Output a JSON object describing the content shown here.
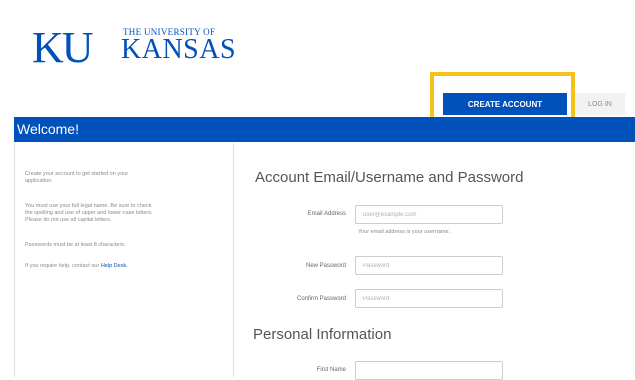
{
  "logo": {
    "ku": "KU",
    "university_line": "THE UNIVERSITY OF",
    "name": "KANSAS"
  },
  "tabs": {
    "create_account": "CREATE ACCOUNT",
    "log_in": "LOG IN"
  },
  "banner": {
    "title": "Welcome!"
  },
  "sidebar": {
    "lines": [
      "Create your account to get started on your",
      "application.",
      "You must use your full legal name. Be sure to check",
      "the spelling and use of upper and lower-case letters.",
      "Please do not use all capital letters.",
      "Passwords must be at least 8 characters.",
      "If you require help, contact our"
    ],
    "help_link": "Help Desk."
  },
  "account_section": {
    "title": "Account Email/Username and Password",
    "email": {
      "label": "Email Address",
      "placeholder": "user@example.com",
      "hint": "Your email address is your username."
    },
    "new_password": {
      "label": "New Password",
      "placeholder": "Password"
    },
    "confirm_password": {
      "label": "Confirm Password",
      "placeholder": "Password"
    }
  },
  "personal_section": {
    "title": "Personal Information",
    "first_name": {
      "label": "First Name",
      "placeholder": ""
    }
  },
  "colors": {
    "ku_blue": "#0051ba",
    "highlight": "#f4c21a"
  }
}
